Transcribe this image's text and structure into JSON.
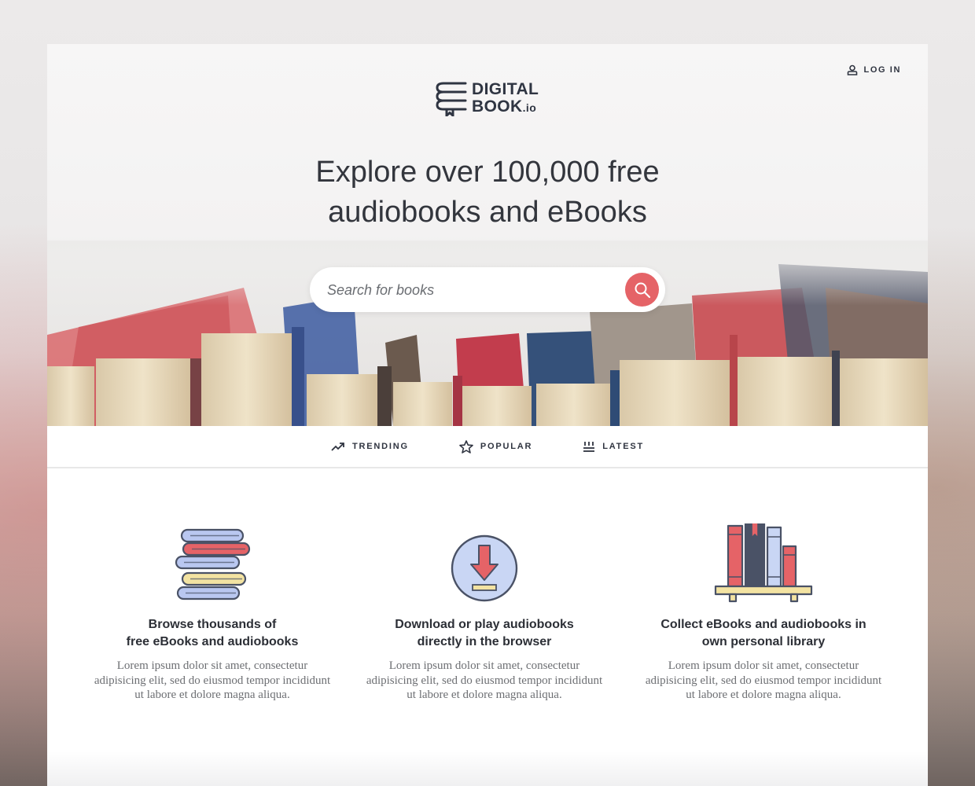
{
  "header": {
    "login_label": "LOG IN",
    "logo_line1": "DIGITAL",
    "logo_line2": "BOOK",
    "logo_suffix": ".io"
  },
  "hero": {
    "headline_line1": "Explore over 100,000 free",
    "headline_line2": "audiobooks and eBooks",
    "search_placeholder": "Search for books"
  },
  "tabs": [
    {
      "label": "TRENDING",
      "icon": "trending-icon"
    },
    {
      "label": "POPULAR",
      "icon": "star-icon"
    },
    {
      "label": "LATEST",
      "icon": "latest-icon"
    }
  ],
  "features": [
    {
      "icon": "book-stack-icon",
      "title_line1": "Browse thousands of",
      "title_line2": "free eBooks and audiobooks",
      "body": "Lorem ipsum dolor sit amet, consectetur adipisicing elit, sed do eiusmod tempor incididunt ut labore et dolore magna aliqua."
    },
    {
      "icon": "download-icon",
      "title_line1": "Download or play audiobooks",
      "title_line2": "directly in the browser",
      "body": "Lorem ipsum dolor sit amet, consectetur adipisicing elit, sed do eiusmod tempor incididunt ut labore et dolore magna aliqua."
    },
    {
      "icon": "bookshelf-icon",
      "title_line1": "Collect eBooks and audiobooks in",
      "title_line2": "own personal library",
      "body": "Lorem ipsum dolor sit amet, consectetur adipisicing elit, sed do eiusmod tempor incididunt ut labore et dolore magna aliqua."
    }
  ],
  "colors": {
    "accent": "#e56367",
    "text_dark": "#2f3440",
    "icon_blue": "#b9c7f0",
    "icon_red": "#e56367",
    "icon_yellow": "#f3e3a2",
    "icon_outline": "#4a5266"
  }
}
